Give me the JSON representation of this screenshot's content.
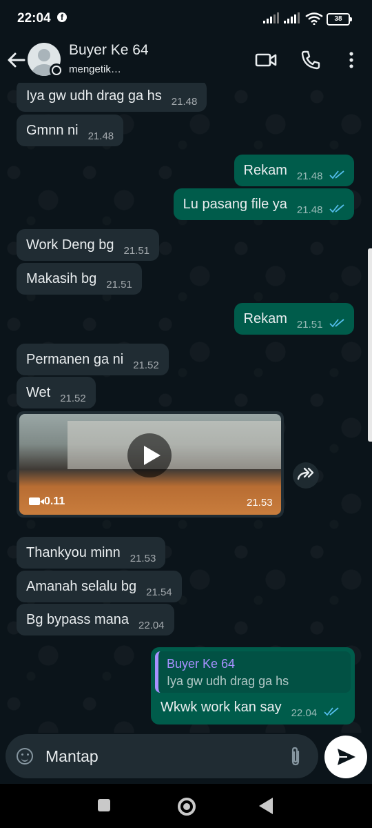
{
  "status_bar": {
    "time": "22:04",
    "notification_icon": "f",
    "battery": "38"
  },
  "header": {
    "contact_name": "Buyer Ke 64",
    "status": "mengetik…"
  },
  "messages": [
    {
      "direction": "in",
      "text": "Iya gw udh drag ga hs",
      "time": "21.48"
    },
    {
      "direction": "in",
      "text": "Gmnn ni",
      "time": "21.48"
    },
    {
      "direction": "out",
      "text": "Rekam",
      "time": "21.48",
      "read": true
    },
    {
      "direction": "out",
      "text": "Lu pasang file ya",
      "time": "21.48",
      "read": true
    },
    {
      "direction": "in",
      "text": "Work Deng bg",
      "time": "21.51"
    },
    {
      "direction": "in",
      "text": "Makasih bg",
      "time": "21.51"
    },
    {
      "direction": "out",
      "text": "Rekam",
      "time": "21.51",
      "read": true
    },
    {
      "direction": "in",
      "text": "Permanen ga ni",
      "time": "21.52"
    },
    {
      "direction": "in",
      "text": "Wet",
      "time": "21.52"
    },
    {
      "direction": "in",
      "text": "Thankyou minn",
      "time": "21.53"
    },
    {
      "direction": "in",
      "text": "Amanah selalu bg",
      "time": "21.54"
    },
    {
      "direction": "in",
      "text": "Bg bypass mana",
      "time": "22.04"
    }
  ],
  "video_message": {
    "duration": "0.11",
    "time": "21.53"
  },
  "reply_message": {
    "quoted_name": "Buyer Ke 64",
    "quoted_text": "Iya gw udh drag ga hs",
    "text": "Wkwk work kan say",
    "time": "22.04",
    "read": true
  },
  "composer": {
    "value": "Mantap",
    "placeholder": "Message"
  },
  "colors": {
    "incoming": "#202c33",
    "outgoing": "#005c4b",
    "read_ticks": "#53bdeb",
    "background": "#0b141a",
    "quote_accent": "#a791ff"
  }
}
